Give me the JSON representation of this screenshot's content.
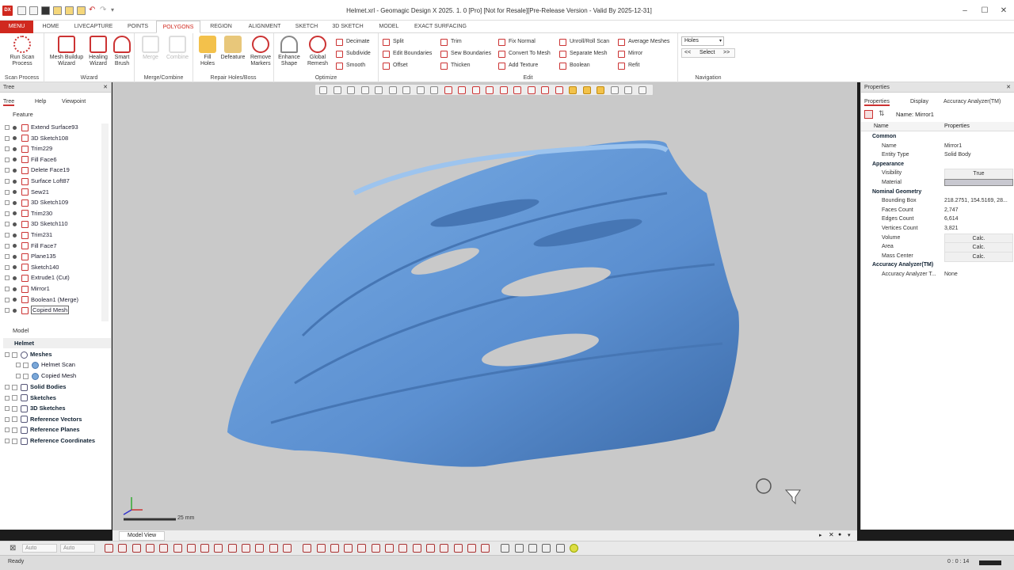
{
  "window": {
    "title": "Helmet.xrl - Geomagic Design X 2025. 1. 0 [Pro] [Not for Resale][Pre-Release Version - Valid By 2025-12-31]",
    "logo": "DX"
  },
  "menu_tabs": [
    "MENU",
    "HOME",
    "LIVECAPTURE",
    "POINTS",
    "POLYGONS",
    "REGION",
    "ALIGNMENT",
    "SKETCH",
    "3D SKETCH",
    "MODEL",
    "EXACT SURFACING"
  ],
  "active_tab": "POLYGONS",
  "ribbon": {
    "groups": [
      "Scan Process",
      "Wizard",
      "Merge/Combine",
      "Repair Holes/Boss",
      "Optimize",
      "Edit",
      "Navigation"
    ],
    "run_scan": "Run Scan\nProcess",
    "mesh_buildup": "Mesh Buildup\nWizard",
    "healing": "Healing\nWizard",
    "smart_brush": "Smart\nBrush",
    "merge": "Merge",
    "combine": "Combine",
    "fill_holes": "Fill\nHoles",
    "defeature": "Defeature",
    "remove_markers": "Remove\nMarkers",
    "enhance_shape": "Enhance\nShape",
    "global_remesh": "Global\nRemesh",
    "decimate": "Decimate",
    "subdivide": "Subdivide",
    "smooth": "Smooth",
    "split": "Split",
    "edit_boundaries": "Edit Boundaries",
    "offset": "Offset",
    "trim": "Trim",
    "sew_boundaries": "Sew Boundaries",
    "thicken": "Thicken",
    "fix_normal": "Fix Normal",
    "convert_to_mesh": "Convert To Mesh",
    "add_texture": "Add Texture",
    "unroll_roll_scan": "Unroll/Roll Scan",
    "separate_mesh": "Separate Mesh",
    "boolean": "Boolean",
    "average_meshes": "Average Meshes",
    "mirror": "Mirror",
    "refit": "Refit",
    "holes_combo": "Holes",
    "select": "Select",
    "nav_prev": "<<",
    "nav_next": ">>"
  },
  "tree_panel": {
    "title": "Tree",
    "tabs": [
      "Tree",
      "Help",
      "Viewpoint"
    ],
    "feature_header": "Feature",
    "features": [
      "Extend Surface93",
      "3D Sketch108",
      "Trim229",
      "Fill Face6",
      "Delete Face19",
      "Surface Loft87",
      "Sew21",
      "3D Sketch109",
      "Trim230",
      "3D Sketch110",
      "Trim231",
      "Fill Face7",
      "Plane135",
      "Sketch140",
      "Extrude1 (Cut)",
      "Mirror1",
      "Boolean1 (Merge)",
      "Copied Mesh"
    ],
    "model_header": "Model",
    "model_root": "Helmet",
    "meshes": "Meshes",
    "mesh_items": [
      "Helmet Scan",
      "Copied Mesh"
    ],
    "groups": [
      "Solid Bodies",
      "Sketches",
      "3D Sketches",
      "Reference Vectors",
      "Reference Planes",
      "Reference Coordinates"
    ]
  },
  "properties_panel": {
    "title": "Properties",
    "tabs": [
      "Properties",
      "Display",
      "Accuracy Analyzer(TM)"
    ],
    "name_label": "Name: Mirror1",
    "col_name": "Name",
    "col_props": "Properties",
    "sections": {
      "common": "Common",
      "appearance": "Appearance",
      "nominal": "Nominal Geometry",
      "accuracy": "Accuracy Analyzer(TM)"
    },
    "rows": {
      "name": [
        "Name",
        "Mirror1"
      ],
      "entity_type": [
        "Entity Type",
        "Solid Body"
      ],
      "visibility": [
        "Visibility",
        "True"
      ],
      "material": [
        "Material",
        ""
      ],
      "bbox": [
        "Bounding Box",
        "218.2751, 154.5169, 28..."
      ],
      "faces": [
        "Faces Count",
        "2,747"
      ],
      "edges": [
        "Edges Count",
        "6,614"
      ],
      "vertices": [
        "Vertices Count",
        "3,821"
      ],
      "volume": [
        "Volume",
        "Calc."
      ],
      "area": [
        "Area",
        "Calc."
      ],
      "mass_center": [
        "Mass Center",
        "Calc."
      ],
      "accuracy_t": [
        "Accuracy Analyzer T...",
        "None"
      ]
    }
  },
  "viewport": {
    "scale_label": "25 mm",
    "tab_label": "Model View",
    "helmet_color": "#5b8fd0",
    "background": "#c9c9c9"
  },
  "bottom_toolbar": {
    "auto1": "Auto",
    "auto2": "Auto"
  },
  "status": {
    "left": "Ready",
    "right": "0 : 0 : 14"
  },
  "colors": {
    "accent": "#d0281e"
  }
}
